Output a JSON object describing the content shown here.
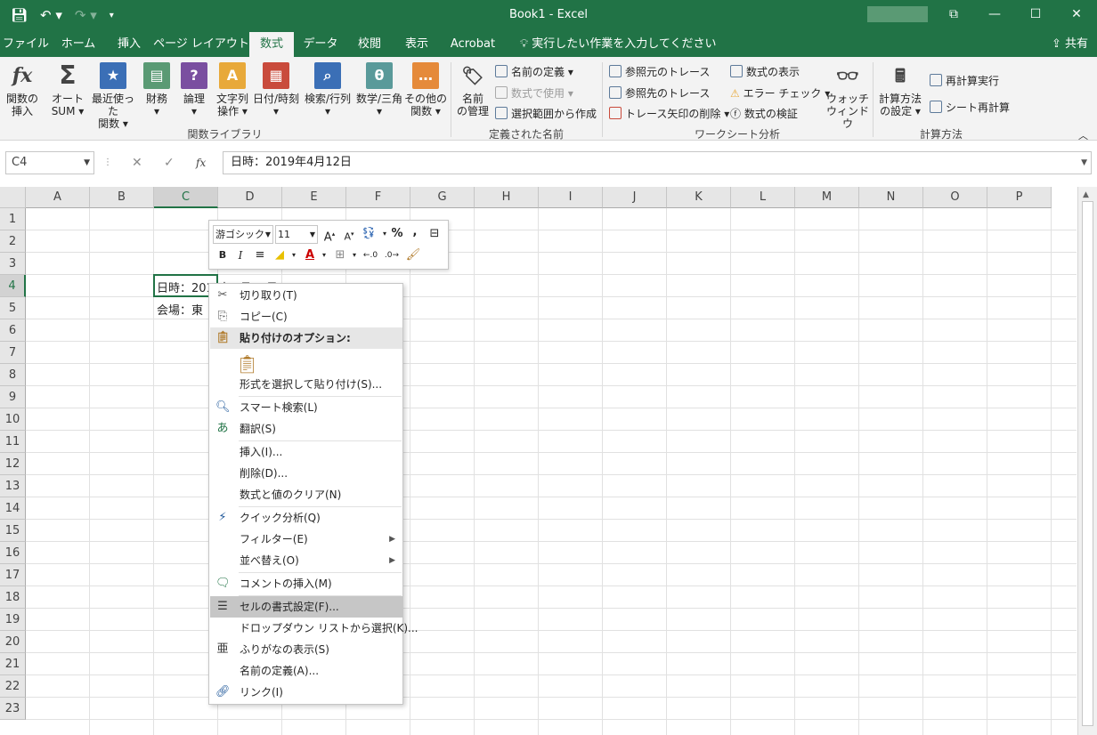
{
  "window": {
    "title": "Book1  -  Excel"
  },
  "tabs": [
    "ファイル",
    "ホーム",
    "挿入",
    "ページ レイアウト",
    "数式",
    "データ",
    "校閲",
    "表示",
    "Acrobat"
  ],
  "active_tab": "数式",
  "tell_me": "実行したい作業を入力してください",
  "share": "共有",
  "ribbon": {
    "function_library": {
      "label": "関数ライブラリ",
      "buttons": [
        {
          "label1": "関数の",
          "label2": "挿入",
          "icon": "fx-icon"
        },
        {
          "label1": "オート",
          "label2": "SUM",
          "icon": "sigma-icon"
        },
        {
          "label1": "最近使った",
          "label2": "関数",
          "icon": "star-book-icon"
        },
        {
          "label1": "財務",
          "label2": "",
          "icon": "finance-book-icon"
        },
        {
          "label1": "論理",
          "label2": "",
          "icon": "logic-book-icon"
        },
        {
          "label1": "文字列",
          "label2": "操作",
          "icon": "text-book-icon"
        },
        {
          "label1": "日付/時刻",
          "label2": "",
          "icon": "calendar-book-icon"
        },
        {
          "label1": "検索/行列",
          "label2": "",
          "icon": "lookup-book-icon"
        },
        {
          "label1": "数学/三角",
          "label2": "",
          "icon": "math-book-icon"
        },
        {
          "label1": "その他の",
          "label2": "関数",
          "icon": "more-book-icon"
        }
      ]
    },
    "defined_names": {
      "label": "定義された名前",
      "manager1": "名前",
      "manager2": "の管理",
      "items": [
        "名前の定義",
        "数式で使用",
        "選択範囲から作成"
      ]
    },
    "auditing": {
      "label": "ワークシート分析",
      "items": [
        "参照元のトレース",
        "参照先のトレース",
        "トレース矢印の削除",
        "数式の表示",
        "エラー チェック",
        "数式の検証"
      ],
      "watch1": "ウォッチ",
      "watch2": "ウィンドウ"
    },
    "calculation": {
      "label": "計算方法",
      "options1": "計算方法",
      "options2": "の設定",
      "items": [
        "再計算実行",
        "シート再計算"
      ]
    }
  },
  "formula_bar": {
    "name_box": "C4",
    "fx": "fx",
    "content": "日時：2019年4月12日"
  },
  "columns": [
    "A",
    "B",
    "C",
    "D",
    "E",
    "F",
    "G",
    "H",
    "I",
    "J",
    "K",
    "L",
    "M",
    "N",
    "O",
    "P"
  ],
  "rows": [
    "1",
    "2",
    "3",
    "4",
    "5",
    "6",
    "7",
    "8",
    "9",
    "10",
    "11",
    "12",
    "13",
    "14",
    "15",
    "16",
    "17",
    "18",
    "19",
    "20",
    "21",
    "22",
    "23"
  ],
  "cells": {
    "c4": "日時：2019年4月12日",
    "c5": "会場：東"
  },
  "mini_toolbar": {
    "font": "游ゴシック",
    "size": "11",
    "percent": "%",
    "comma": ","
  },
  "context_menu": {
    "cut": "切り取り(T)",
    "copy": "コピー(C)",
    "paste_options": "貼り付けのオプション:",
    "paste_special": "形式を選択して貼り付け(S)...",
    "smart_lookup": "スマート検索(L)",
    "translate": "翻訳(S)",
    "insert": "挿入(I)...",
    "delete": "削除(D)...",
    "clear": "数式と値のクリア(N)",
    "quick_analysis": "クイック分析(Q)",
    "filter": "フィルター(E)",
    "sort": "並べ替え(O)",
    "insert_comment": "コメントの挿入(M)",
    "format_cells": "セルの書式設定(F)...",
    "dropdown": "ドロップダウン リストから選択(K)...",
    "phonetic": "ふりがなの表示(S)",
    "define_name": "名前の定義(A)...",
    "link": "リンク(I)"
  }
}
